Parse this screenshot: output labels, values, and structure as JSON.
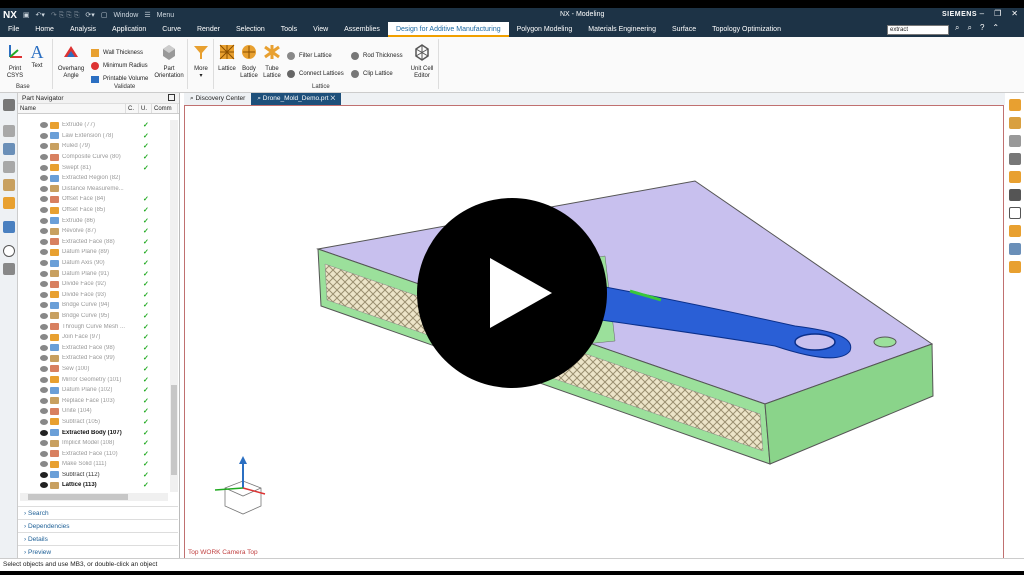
{
  "app": {
    "logo": "NX",
    "title": "NX - Modeling",
    "brand": "SIEMENS",
    "window_menu": "Window",
    "menu": "Menu"
  },
  "tabs": [
    "File",
    "Home",
    "Analysis",
    "Application",
    "Curve",
    "Render",
    "Selection",
    "Tools",
    "View",
    "Assemblies",
    "Design for Additive Manufacturing",
    "Polygon Modeling",
    "Materials Engineering",
    "Surface",
    "Topology Optimization"
  ],
  "active_tab": "Design for Additive Manufacturing",
  "search": {
    "value": "extract"
  },
  "ribbon": {
    "print_csys": "Print CSYS",
    "text": "Text",
    "base": "Base",
    "overhang_angle": "Overhang Angle",
    "wall_thickness": "Wall Thickness",
    "minimum_radius": "Minimum Radius",
    "printable_volume": "Printable Volume",
    "part_orientation": "Part Orientation",
    "validate": "Validate",
    "more": "More",
    "lattice": "Lattice",
    "body_lattice": "Body Lattice",
    "tube_lattice": "Tube Lattice",
    "filter_lattice": "Filter Lattice",
    "connect_lattices": "Connect Lattices",
    "rod_thickness": "Rod Thickness",
    "clip_lattice": "Clip Lattice",
    "unit_cell_editor": "Unit Cell Editor",
    "lattice_group": "Lattice"
  },
  "navigator": {
    "title": "Part Navigator",
    "columns": [
      "Name",
      "C.",
      "U.",
      "Comm"
    ],
    "rows": [
      {
        "name": "Extrude (77)",
        "chk": "✓"
      },
      {
        "name": "Law Extension (78)",
        "chk": "✓"
      },
      {
        "name": "Ruled (79)",
        "chk": "✓"
      },
      {
        "name": "Composite Curve (80)",
        "chk": "✓"
      },
      {
        "name": "Swept (81)",
        "chk": "✓"
      },
      {
        "name": "Extracted Region (82)",
        "chk": ""
      },
      {
        "name": "Distance Measureme...",
        "chk": ""
      },
      {
        "name": "Offset Face (84)",
        "chk": "✓"
      },
      {
        "name": "Offset Face (85)",
        "chk": "✓"
      },
      {
        "name": "Extrude (86)",
        "chk": "✓"
      },
      {
        "name": "Revolve (87)",
        "chk": "✓"
      },
      {
        "name": "Extracted Face (88)",
        "chk": "✓"
      },
      {
        "name": "Datum Plane (89)",
        "chk": "✓"
      },
      {
        "name": "Datum Axis (90)",
        "chk": "✓"
      },
      {
        "name": "Datum Plane (91)",
        "chk": "✓"
      },
      {
        "name": "Divide Face (92)",
        "chk": "✓"
      },
      {
        "name": "Divide Face (93)",
        "chk": "✓"
      },
      {
        "name": "Bridge Curve (94)",
        "chk": "✓"
      },
      {
        "name": "Bridge Curve (95)",
        "chk": "✓"
      },
      {
        "name": "Through Curve Mesh ...",
        "chk": "✓"
      },
      {
        "name": "Join Face (97)",
        "chk": "✓"
      },
      {
        "name": "Extracted Face (98)",
        "chk": "✓"
      },
      {
        "name": "Extracted Face (99)",
        "chk": "✓"
      },
      {
        "name": "Sew (100)",
        "chk": "✓"
      },
      {
        "name": "Mirror Geometry (101)",
        "chk": "✓"
      },
      {
        "name": "Datum Plane (102)",
        "chk": "✓"
      },
      {
        "name": "Replace Face (103)",
        "chk": "✓"
      },
      {
        "name": "Unite (104)",
        "chk": "✓"
      },
      {
        "name": "Subtract (105)",
        "chk": "✓"
      },
      {
        "name": "Extracted Body (107)",
        "chk": "✓",
        "style": "bold"
      },
      {
        "name": "Implicit Model (108)",
        "chk": "✓"
      },
      {
        "name": "Extracted Face (110)",
        "chk": "✓"
      },
      {
        "name": "Make Solid (111)",
        "chk": "✓"
      },
      {
        "name": "Subtract (112)",
        "chk": "✓",
        "style": "dark"
      },
      {
        "name": "Lattice (113)",
        "chk": "✓",
        "style": "bold"
      }
    ],
    "sections": [
      "Search",
      "Dependencies",
      "Details",
      "Preview"
    ]
  },
  "doc_tabs": [
    "Discovery Center",
    "Drone_Mold_Demo.prt"
  ],
  "view_label": "Top WORK Camera Top",
  "status": "Select objects and use MB3, or double-click an object",
  "colors": {
    "titlebar": "#1d3346",
    "accent": "#f0a000",
    "body_top": "#c8c0ee",
    "body_side": "#9be09b",
    "lattice": "#e8e0c4",
    "drone": "#2a5fd6"
  }
}
